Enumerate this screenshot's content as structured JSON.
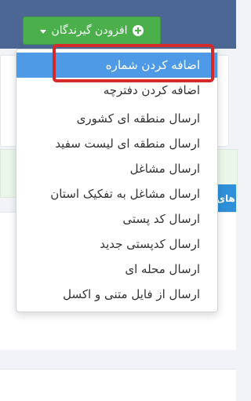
{
  "header": {
    "add_recipients_label": "افزودن گیرندگان",
    "accent_color": "#4c6793",
    "button_color": "#4bb04b"
  },
  "background": {
    "tab_label": "های"
  },
  "dropdown": {
    "items": [
      {
        "label": "اضافه کردن شماره",
        "active": true
      },
      {
        "label": "اضافه کردن دفترچه",
        "active": false
      },
      {
        "label": "ارسال منطقه ای کشوری",
        "active": false
      },
      {
        "label": "ارسال منطقه ای لیست سفید",
        "active": false
      },
      {
        "label": "ارسال مشاغل",
        "active": false
      },
      {
        "label": "ارسال مشاغل به تفکیک استان",
        "active": false
      },
      {
        "label": "ارسال کد پستی",
        "active": false
      },
      {
        "label": "ارسال کدپستی جدید",
        "active": false
      },
      {
        "label": "ارسال محله ای",
        "active": false
      },
      {
        "label": "ارسال از فایل متنی و اکسل",
        "active": false
      }
    ],
    "active_color": "#4f9ae6",
    "highlight_color": "#d62a2a"
  }
}
